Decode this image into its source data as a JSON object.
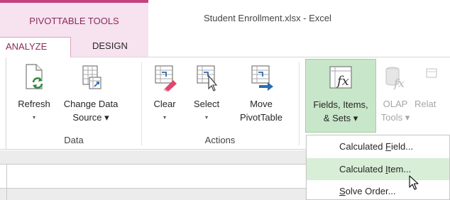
{
  "titlebar": {
    "context_title": "PIVOTTABLE TOOLS",
    "window_title": "Student Enrollment.xlsx - Excel"
  },
  "tabs": [
    {
      "label": "ANALYZE",
      "active": true
    },
    {
      "label": "DESIGN",
      "active": false
    }
  ],
  "ribbon": {
    "groups": [
      {
        "label": "Data",
        "buttons": [
          {
            "line1": "Refresh",
            "line2": "▾",
            "icon": "refresh-icon"
          },
          {
            "line1": "Change Data",
            "line2": "Source ▾",
            "icon": "change-data-source-icon"
          }
        ]
      },
      {
        "label": "Actions",
        "buttons": [
          {
            "line1": "Clear",
            "line2": "▾",
            "icon": "clear-icon"
          },
          {
            "line1": "Select",
            "line2": "▾",
            "icon": "select-icon"
          },
          {
            "line1": "Move",
            "line2": "PivotTable",
            "icon": "move-pivottable-icon"
          }
        ]
      },
      {
        "label": "",
        "buttons": [
          {
            "line1": "Fields, Items,",
            "line2": "& Sets ▾",
            "icon": "fields-items-sets-icon",
            "active": true
          },
          {
            "line1": "OLAP",
            "line2": "Tools ▾",
            "icon": "olap-tools-icon",
            "disabled": true
          },
          {
            "line1": "Relat",
            "line2": "",
            "icon": "relationships-icon",
            "disabled": true
          }
        ]
      }
    ]
  },
  "menu": {
    "items": [
      {
        "pre": "Calculated ",
        "mnemonic": "F",
        "post": "ield...",
        "hover": false
      },
      {
        "pre": "Calculated ",
        "mnemonic": "I",
        "post": "tem...",
        "hover": true
      },
      {
        "pre": "",
        "mnemonic": "S",
        "post": "olve Order...",
        "hover": false
      }
    ]
  },
  "colors": {
    "context_accent": "#c2447e",
    "context_bg": "#f7e2ef",
    "active_button_bg": "#c8e6c9",
    "menu_hover_bg": "#d8eed6",
    "excel_green": "#217346"
  }
}
